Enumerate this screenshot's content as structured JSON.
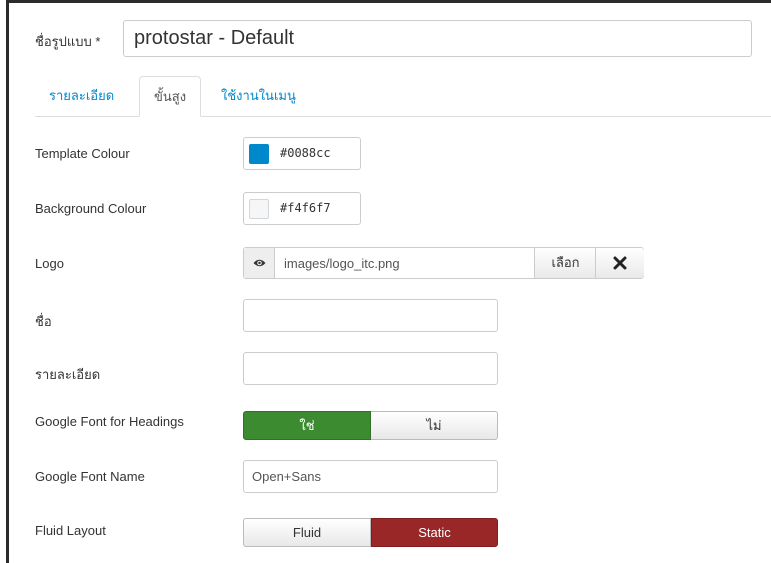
{
  "form": {
    "title_label": "ชื่อรูปแบบ *",
    "title_value": "protostar - Default"
  },
  "tabs": [
    {
      "label": "รายละเอียด",
      "active": false
    },
    {
      "label": "ขั้นสูง",
      "active": true
    },
    {
      "label": "ใช้งานในเมนู",
      "active": false
    }
  ],
  "fields": {
    "template_colour": {
      "label": "Template Colour",
      "value": "#0088cc",
      "swatch": "#0088cc"
    },
    "background_colour": {
      "label": "Background Colour",
      "value": "#f4f6f7",
      "swatch": "#f4f6f7"
    },
    "logo": {
      "label": "Logo",
      "path": "images/logo_itc.png",
      "select_label": "เลือก",
      "preview_icon": "eye-icon",
      "clear_icon": "close-icon"
    },
    "name": {
      "label": "ชื่อ",
      "value": ""
    },
    "description": {
      "label": "รายละเอียด",
      "value": ""
    },
    "google_font_headings": {
      "label": "Google Font for Headings",
      "yes_label": "ใช่",
      "no_label": "ไม่",
      "selected": "yes"
    },
    "google_font_name": {
      "label": "Google Font Name",
      "value": "Open+Sans"
    },
    "fluid_layout": {
      "label": "Fluid Layout",
      "fluid_label": "Fluid",
      "static_label": "Static",
      "selected": "static"
    }
  },
  "colors": {
    "link": "#0088cc",
    "yes_active": "#3c8b31",
    "static_active": "#992727"
  }
}
